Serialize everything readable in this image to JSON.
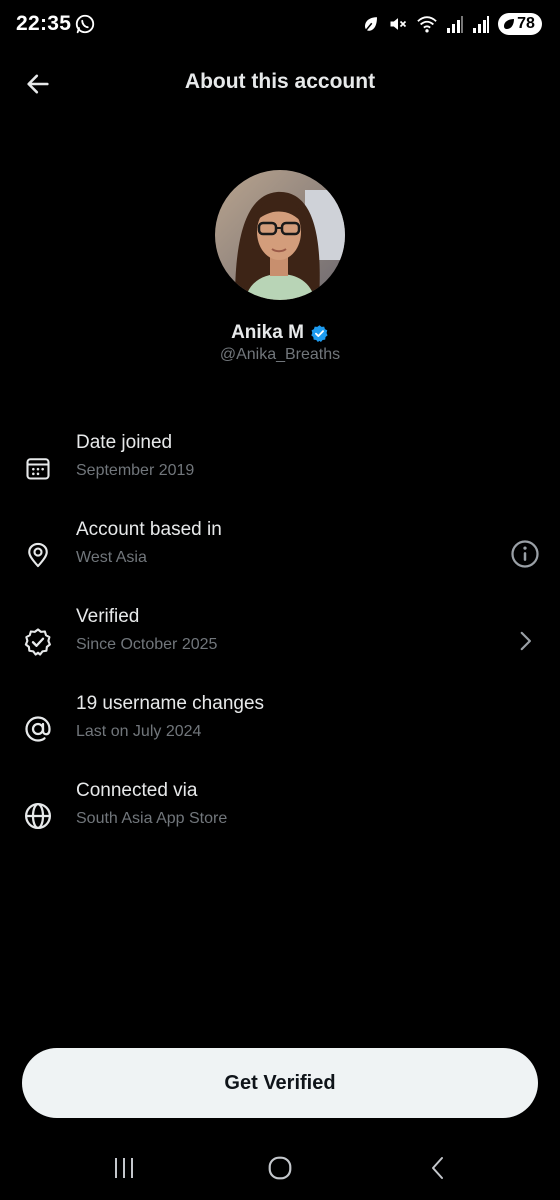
{
  "status_bar": {
    "time": "22:35",
    "battery": "78",
    "icons": [
      "whatsapp-icon",
      "leaf-icon",
      "mute-icon",
      "wifi-icon",
      "signal-icon",
      "signal-icon",
      "battery-icon"
    ]
  },
  "header": {
    "title": "About this account",
    "back_icon": "arrow-left-icon"
  },
  "profile": {
    "name": "Anika M",
    "handle": "@Anika_Breaths",
    "verified": true,
    "badge_color": "#1d9bf0"
  },
  "info_items": [
    {
      "title": "Date joined",
      "subtitle": "September 2019",
      "icon": "calendar-icon"
    },
    {
      "title": "Account based in",
      "subtitle": "West Asia",
      "icon": "location-pin-icon",
      "trailing_icon": "info-icon"
    },
    {
      "title": "Verified",
      "subtitle": "Since October 2025",
      "icon": "verified-outline-icon",
      "trailing_icon": "chevron-right-icon"
    },
    {
      "title": "19 username changes",
      "subtitle": "Last on July 2024",
      "icon": "at-sign-icon"
    },
    {
      "title": "Connected via",
      "subtitle": "South Asia App Store",
      "icon": "globe-icon"
    }
  ],
  "cta": {
    "label": "Get Verified"
  },
  "nav_bar": {
    "icons": [
      "recent-apps-icon",
      "home-icon",
      "back-icon"
    ]
  },
  "colors": {
    "background": "#000000",
    "text_primary": "#e7e9ea",
    "text_secondary": "#71767b",
    "button_bg": "#eff3f4",
    "accent": "#1d9bf0"
  }
}
